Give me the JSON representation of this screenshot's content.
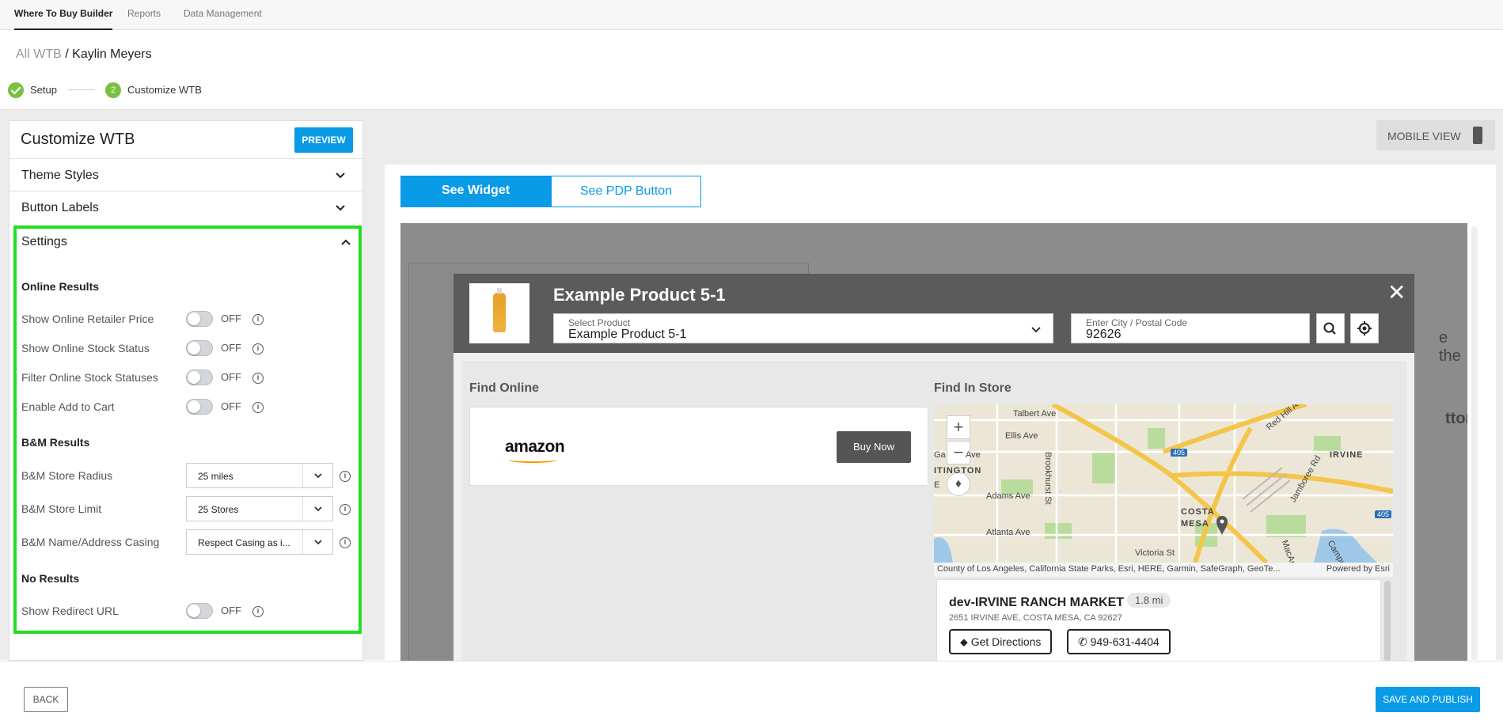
{
  "topnav": {
    "tabs": [
      {
        "label": "Where To Buy Builder",
        "active": true
      },
      {
        "label": "Reports",
        "active": false
      },
      {
        "label": "Data Management",
        "active": false
      }
    ]
  },
  "breadcrumb": {
    "root": "All WTB",
    "separator": "/",
    "current": "Kaylin Meyers"
  },
  "stepper": {
    "steps": [
      {
        "label": "Setup",
        "state": "done",
        "icon": "check-icon"
      },
      {
        "number": "2",
        "label": "Customize WTB",
        "state": "active"
      }
    ]
  },
  "left_panel": {
    "title": "Customize WTB",
    "preview_label": "PREVIEW",
    "accordions": [
      {
        "label": "Theme Styles",
        "expanded": false
      },
      {
        "label": "Button Labels",
        "expanded": false
      },
      {
        "label": "Settings",
        "expanded": true
      }
    ],
    "settings": {
      "online_title": "Online Results",
      "online_rows": [
        {
          "label": "Show Online Retailer Price",
          "state": "OFF"
        },
        {
          "label": "Show Online Stock Status",
          "state": "OFF"
        },
        {
          "label": "Filter Online Stock Statuses",
          "state": "OFF"
        },
        {
          "label": "Enable Add to Cart",
          "state": "OFF"
        }
      ],
      "bm_title": "B&M Results",
      "bm_rows": [
        {
          "label": "B&M Store Radius",
          "value": "25 miles"
        },
        {
          "label": "B&M Store Limit",
          "value": "25 Stores"
        },
        {
          "label": "B&M Name/Address Casing",
          "value": "Respect Casing as i..."
        }
      ],
      "no_results_title": "No Results",
      "no_results_rows": [
        {
          "label": "Show Redirect URL",
          "state": "OFF"
        }
      ]
    }
  },
  "right_panel": {
    "mobile_view_label": "MOBILE VIEW",
    "tabs": [
      {
        "label": "See Widget",
        "active": true
      },
      {
        "label": "See PDP Button",
        "active": false
      }
    ],
    "stage_text_1": "e the",
    "stage_text_2": "tton"
  },
  "widget": {
    "product_title": "Example Product 5-1",
    "select_product_label": "Select Product",
    "select_product_value": "Example Product 5-1",
    "location_label": "Enter City / Postal Code",
    "location_value": "92626",
    "find_online_title": "Find Online",
    "retailer": "amazon",
    "buy_now_label": "Buy Now",
    "find_in_store_title": "Find In Store",
    "map": {
      "labels": [
        "Talbert Ave",
        "Ellis Ave",
        "Ga",
        "Ave",
        "ITINGTON",
        "E",
        "Adams Ave",
        "Atlanta Ave",
        "Victoria St",
        "Brookhurst St",
        "COSTA",
        "MESA",
        "IRVINE",
        "Red Hill Ave",
        "Jamboree Rd",
        "MacArthur",
        "Campus",
        "405",
        "405"
      ],
      "attribution": "County of Los Angeles, California State Parks, Esri, HERE, Garmin, SafeGraph, GeoTe...",
      "powered_by": "Powered by Esri"
    },
    "store": {
      "name": "dev-IRVINE RANCH MARKET",
      "distance": "1.8 mi",
      "address": "2651 IRVINE AVE, COSTA MESA, CA 92627",
      "directions_label": "Get Directions",
      "phone": "949-631-4404"
    }
  },
  "footer": {
    "back_label": "BACK",
    "publish_label": "SAVE AND PUBLISH"
  },
  "colors": {
    "accent": "#0a9be6",
    "success": "#7ac143",
    "highlight": "#22dd22",
    "widget_header": "#5b5b5b"
  }
}
